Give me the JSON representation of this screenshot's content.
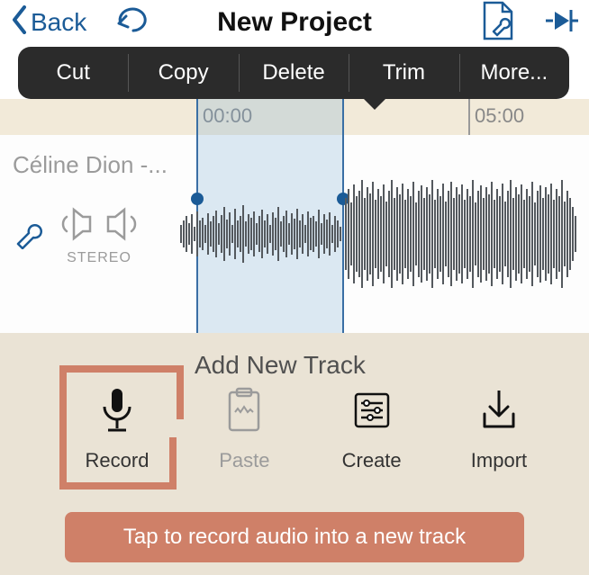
{
  "header": {
    "back_label": "Back",
    "title": "New Project"
  },
  "context_menu": {
    "cut": "Cut",
    "copy": "Copy",
    "delete": "Delete",
    "trim": "Trim",
    "more": "More..."
  },
  "timeline": {
    "t0": "00:00",
    "t5": "05:00"
  },
  "track": {
    "name": "Céline Dion -...",
    "channel_label": "STEREO"
  },
  "panel": {
    "title": "Add New Track",
    "record": "Record",
    "paste": "Paste",
    "create": "Create",
    "import": "Import",
    "tip": "Tap to record audio into a new track"
  },
  "colors": {
    "accent": "#1b5b97",
    "highlight": "#cf8068"
  }
}
